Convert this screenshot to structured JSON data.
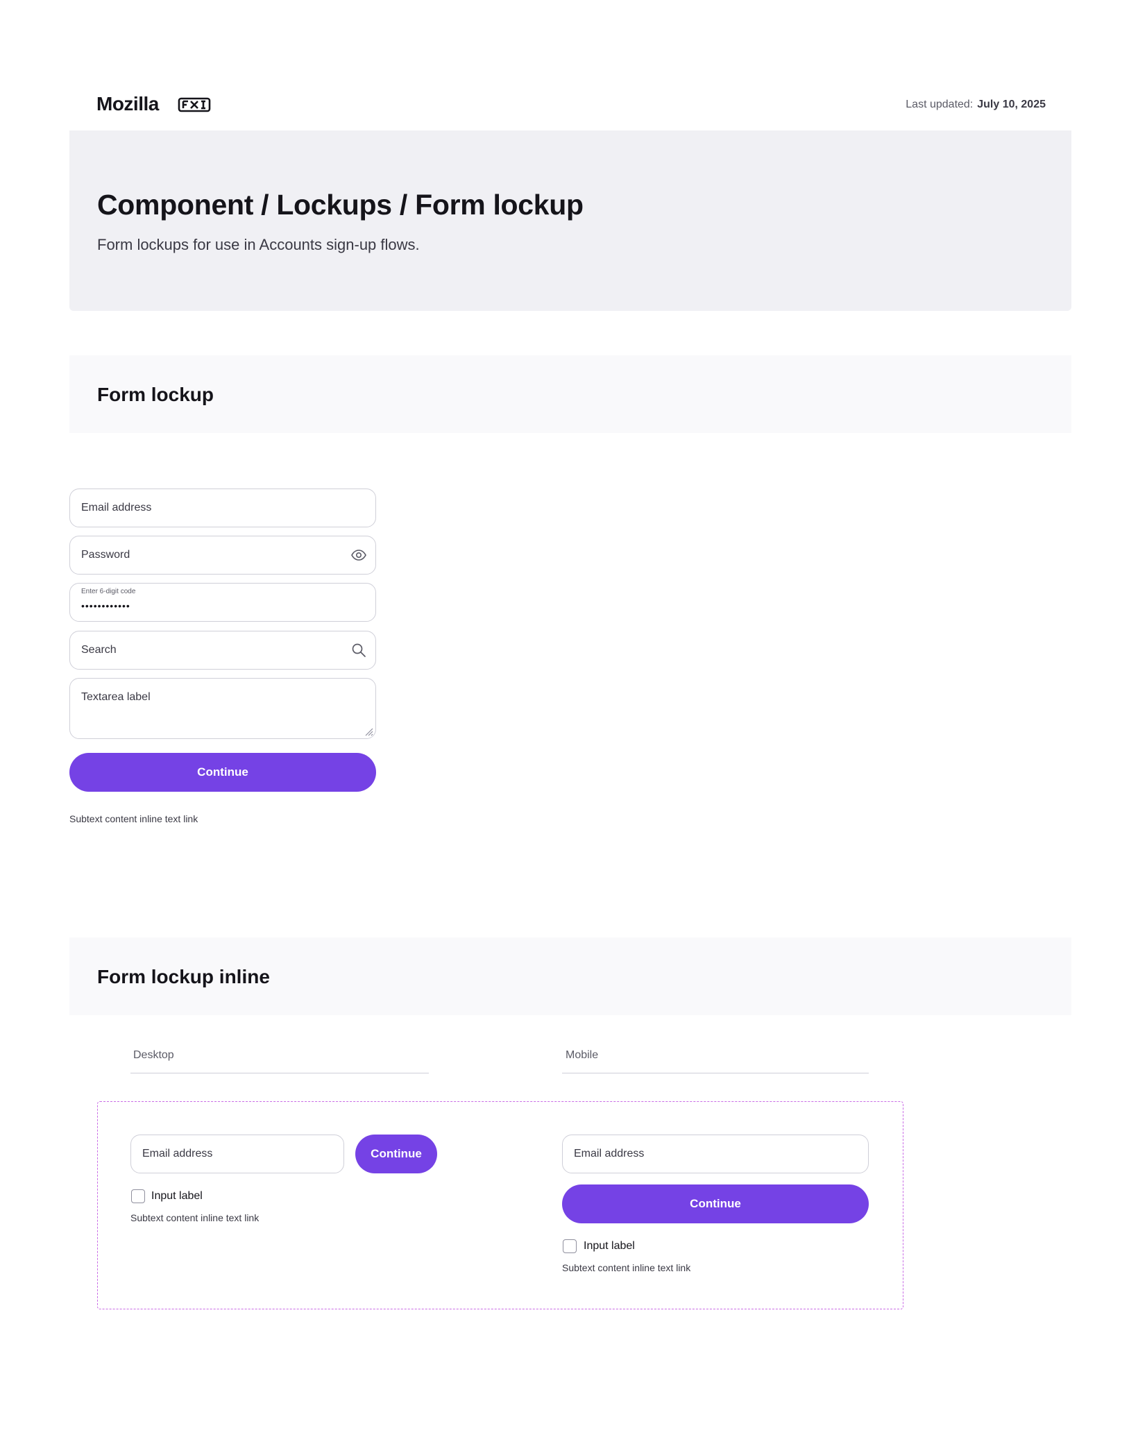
{
  "header": {
    "brand": "Mozilla",
    "product_logo": "fxa-logo-icon",
    "last_updated_label": "Last updated:",
    "last_updated_value": "July 10, 2025"
  },
  "hero": {
    "title": "Component / Lockups / Form lockup",
    "subtitle": "Form lockups for use in Accounts sign-up flows."
  },
  "form_lockup": {
    "section_title": "Form lockup",
    "email_label": "Email address",
    "password_label": "Password",
    "code_label": "Enter 6-digit code",
    "code_value": "••••••••••••",
    "search_label": "Search",
    "textarea_label": "Textarea label",
    "continue_label": "Continue",
    "subtext": "Subtext content inline text link"
  },
  "form_lockup_inline": {
    "section_title": "Form lockup inline",
    "desktop": {
      "column_label": "Desktop",
      "email_label": "Email address",
      "continue_label": "Continue",
      "checkbox_label": "Input label",
      "subtext": "Subtext content inline text link"
    },
    "mobile": {
      "column_label": "Mobile",
      "email_label": "Email address",
      "continue_label": "Continue",
      "checkbox_label": "Input label",
      "subtext": "Subtext content inline text link"
    }
  },
  "colors": {
    "accent": "#7542e5",
    "hero_bg": "#f0f0f4",
    "section_bg": "#f9f9fb",
    "dashed_border": "#c96be6"
  }
}
